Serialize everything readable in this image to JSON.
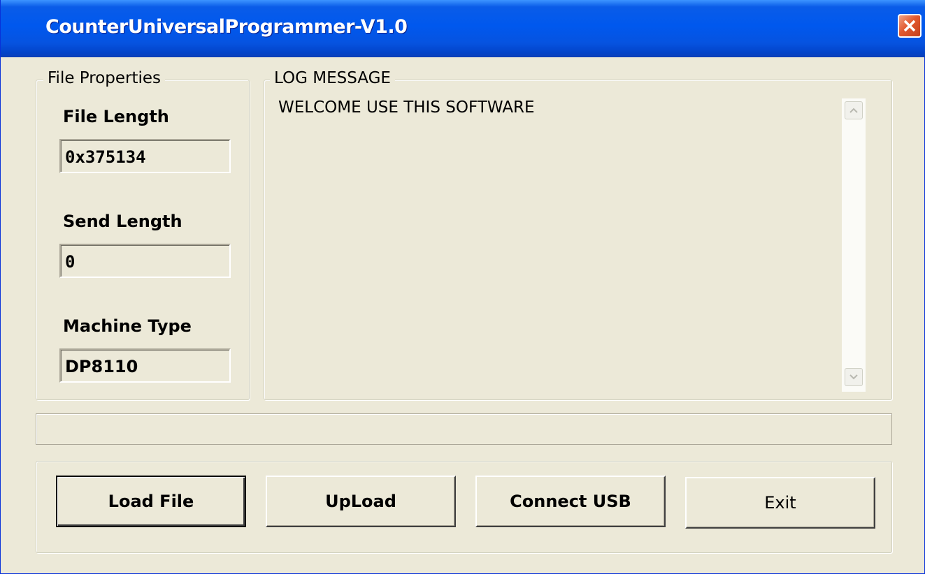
{
  "window": {
    "title": "CounterUniversalProgrammer-V1.0",
    "close_icon": "close-icon"
  },
  "file_properties": {
    "legend": "File Properties",
    "file_length_label": "File Length",
    "file_length_value": "0x375134",
    "send_length_label": "Send Length",
    "send_length_value": "0",
    "machine_type_label": "Machine Type",
    "machine_type_value": "DP8110"
  },
  "log": {
    "legend": "LOG MESSAGE",
    "message": "WELCOME USE THIS SOFTWARE",
    "scroll_up_icon": "scroll-up-icon",
    "scroll_down_icon": "scroll-down-icon"
  },
  "progress": {
    "percent": 0
  },
  "buttons": {
    "load_file": "Load File",
    "upload": "UpLoad",
    "connect_usb": "Connect USB",
    "exit": "Exit"
  },
  "colors": {
    "titlebar": "#0058ee",
    "window_bg": "#ece9d8",
    "close_button": "#e2592f"
  }
}
